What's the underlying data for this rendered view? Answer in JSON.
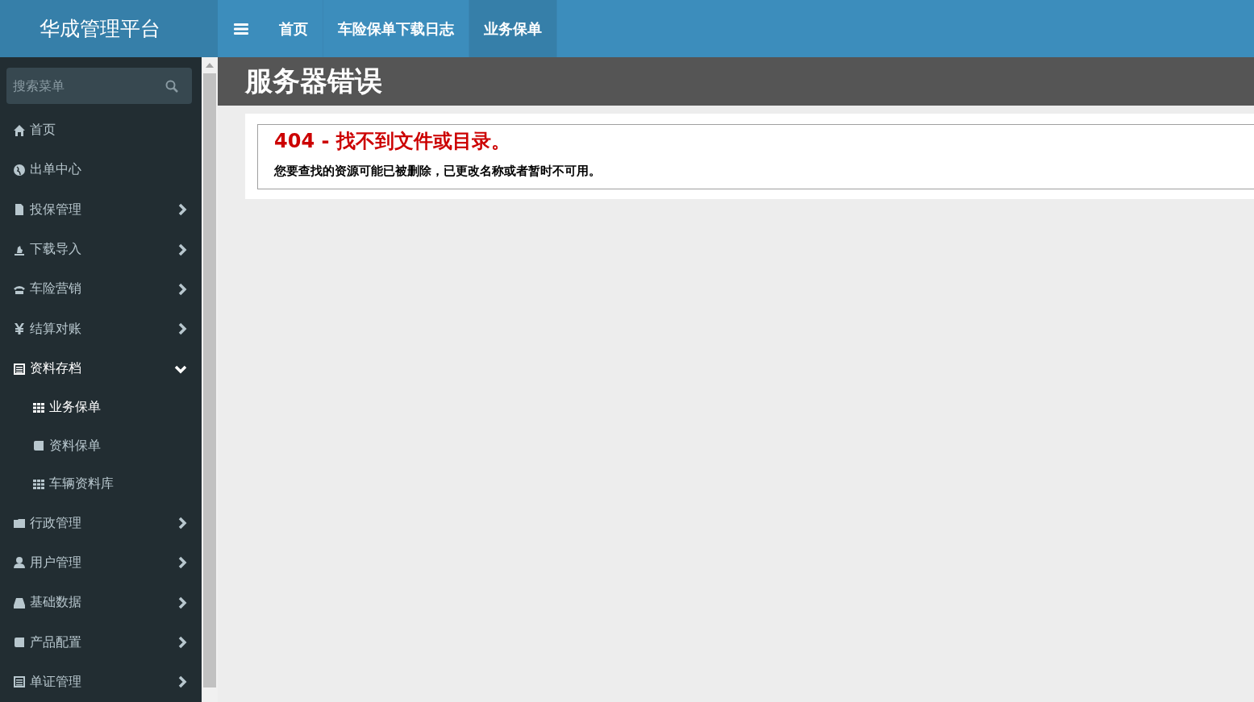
{
  "header": {
    "logo": "华成管理平台",
    "tabs": [
      {
        "label": "首页",
        "selected": false
      },
      {
        "label": "车险保单下载日志",
        "selected": false
      },
      {
        "label": "业务保单",
        "selected": true
      }
    ]
  },
  "sidebar": {
    "search": {
      "placeholder": "搜索菜单"
    },
    "items": [
      {
        "label": "首页",
        "kind": "link"
      },
      {
        "label": "出单中心",
        "kind": "link"
      },
      {
        "label": "投保管理",
        "kind": "menu",
        "expanded": false
      },
      {
        "label": "下载导入",
        "kind": "menu",
        "expanded": false
      },
      {
        "label": "车险营销",
        "kind": "menu",
        "expanded": false
      },
      {
        "label": "结算对账",
        "kind": "menu",
        "expanded": false
      },
      {
        "label": "资料存档",
        "kind": "menu",
        "expanded": true,
        "children": [
          {
            "label": "业务保单",
            "selected": true
          },
          {
            "label": "资料保单",
            "selected": false
          },
          {
            "label": "车辆资料库",
            "selected": false
          }
        ]
      },
      {
        "label": "行政管理",
        "kind": "menu",
        "expanded": false
      },
      {
        "label": "用户管理",
        "kind": "menu",
        "expanded": false
      },
      {
        "label": "基础数据",
        "kind": "menu",
        "expanded": false
      },
      {
        "label": "产品配置",
        "kind": "menu",
        "expanded": false
      },
      {
        "label": "单证管理",
        "kind": "menu",
        "expanded": false
      }
    ]
  },
  "content": {
    "title": "服务器错误",
    "error": {
      "heading": "404 - 找不到文件或目录。",
      "message": "您要查找的资源可能已被删除，已更改名称或者暂时不可用。"
    }
  }
}
